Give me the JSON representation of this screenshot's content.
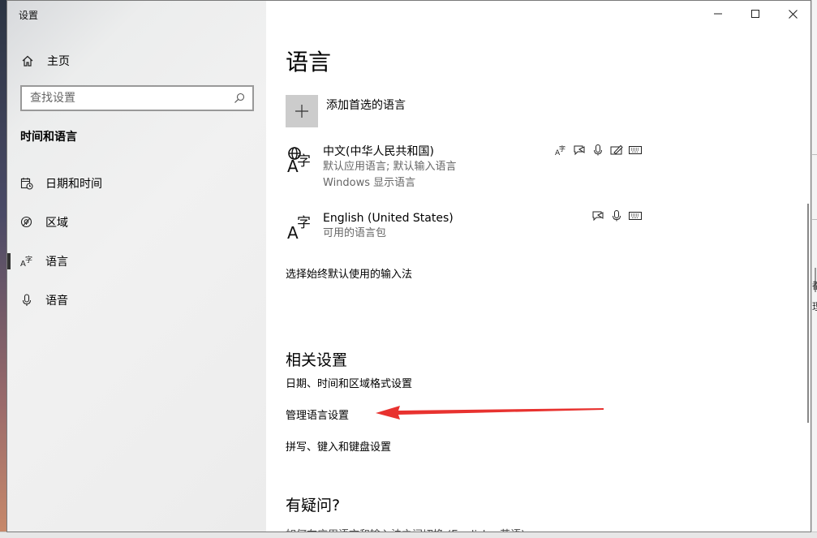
{
  "window": {
    "title": "设置"
  },
  "sidebar": {
    "home_label": "主页",
    "search_placeholder": "查找设置",
    "section_title": "时间和语言",
    "items": [
      {
        "label": "日期和时间",
        "icon": "calendar-clock-icon"
      },
      {
        "label": "区域",
        "icon": "globe-region-icon"
      },
      {
        "label": "语言",
        "icon": "language-icon",
        "selected": true
      },
      {
        "label": "语音",
        "icon": "microphone-icon"
      }
    ]
  },
  "content": {
    "page_title": "语言",
    "add_language_label": "添加首选的语言",
    "languages": [
      {
        "name": "中文(中华人民共和国)",
        "line1": "默认应用语言; 默认输入语言",
        "line2": "Windows 显示语言",
        "features": [
          "display-language-icon",
          "text-to-speech-icon",
          "speech-recognition-icon",
          "handwriting-icon",
          "keyboard-icon"
        ]
      },
      {
        "name": "English (United States)",
        "line1": "可用的语言包",
        "features": [
          "text-to-speech-icon",
          "speech-recognition-icon",
          "keyboard-icon"
        ]
      }
    ],
    "choose_input_link": "选择始终默认使用的输入法",
    "related_heading": "相关设置",
    "related_links": [
      "日期、时间和区域格式设置",
      "管理语言设置",
      "拼写、键入和键盘设置"
    ],
    "help_heading": "有疑问?",
    "help_link_partial": "如何在应用语言和输入法之间切换 (English - 英语)"
  },
  "desktop_right_fragments": [
    "都",
    "理"
  ],
  "colors": {
    "annotation_arrow": "#e8322f",
    "add_tile": "#cccccc",
    "selected_indicator": "#333333"
  }
}
